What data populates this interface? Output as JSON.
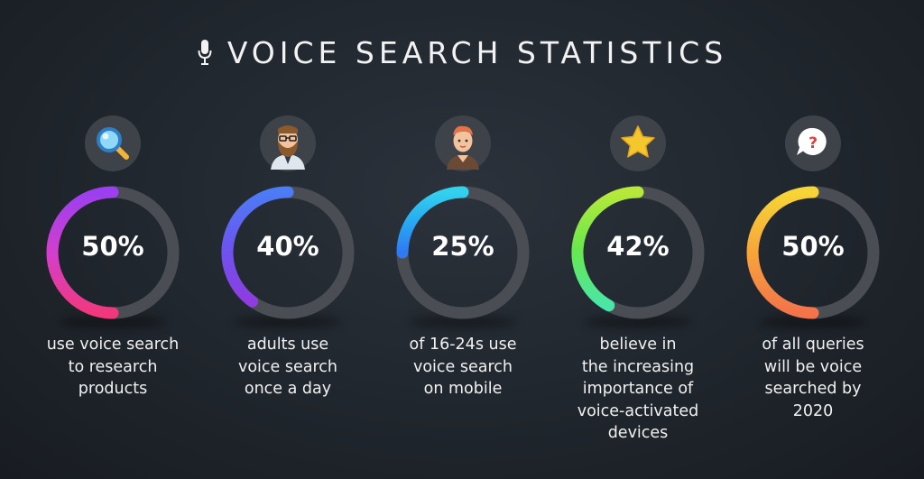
{
  "title": "VOICE SEARCH STATISTICS",
  "title_icon": "microphone-icon",
  "colors": {
    "track": "#4a4e54",
    "badge": "#3e434a"
  },
  "chart_data": {
    "type": "donut",
    "title": "VOICE SEARCH STATISTICS",
    "unit": "%",
    "items": [
      {
        "icon": "magnifier-icon",
        "value": 50,
        "label": "50%",
        "description": [
          "use voice search",
          "to research",
          "products"
        ],
        "gradient": [
          "#f1387d",
          "#d23fcd",
          "#9b3ff0"
        ]
      },
      {
        "icon": "bearded-man-icon",
        "value": 40,
        "label": "40%",
        "description": [
          "adults use",
          "voice search",
          "once a day"
        ],
        "gradient": [
          "#8f3ce0",
          "#6b55f0",
          "#4c7cf6"
        ]
      },
      {
        "icon": "young-man-icon",
        "value": 25,
        "label": "25%",
        "description": [
          "of 16-24s use",
          "voice search",
          "on mobile"
        ],
        "gradient": [
          "#2f7af2",
          "#27a9f2",
          "#32d1ee"
        ]
      },
      {
        "icon": "star-icon",
        "value": 42,
        "label": "42%",
        "description": [
          "believe in",
          "the increasing",
          "importance of",
          "voice-activated",
          "devices"
        ],
        "gradient": [
          "#49e6a8",
          "#69e84c",
          "#b7e83a"
        ]
      },
      {
        "icon": "question-bubble-icon",
        "value": 50,
        "label": "50%",
        "description": [
          "of all queries",
          "will be voice",
          "searched by",
          "2020"
        ],
        "gradient": [
          "#f3734b",
          "#f7a53a",
          "#f6d536"
        ]
      }
    ]
  }
}
